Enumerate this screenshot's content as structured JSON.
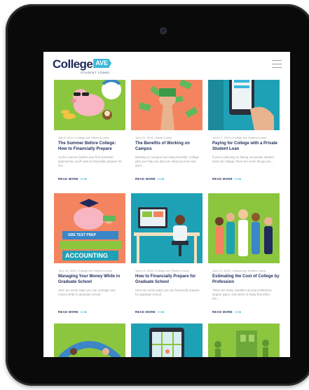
{
  "header": {
    "logo_word": "College",
    "logo_ave": "AVE",
    "logo_sub": "STUDENT LOANS"
  },
  "read_more_label": "READ MORE",
  "cards": [
    {
      "meta": "July 8, 2019 | College Ave Student Loans",
      "title": "The Summer Before College: How to Financially Prepare",
      "excerpt": "As the summer before your first semester approaches you'll want to financially prepare for the..."
    },
    {
      "meta": "June 10, 2019 | Karen Cohen",
      "title": "The Benefits of Working on Campus",
      "excerpt": "Working on campus has many benefits. College jobs can help you discover what you love and don't..."
    },
    {
      "meta": "June 17, 2019 | College Ave Student Loans",
      "title": "Paying for College with a Private Student Loan",
      "excerpt": "If you're planning on taking out private student loans for college, there are some things you..."
    },
    {
      "meta": "June 14, 2019 | College Ave Student Loans",
      "title": "Managing Your Money While in Graduate School",
      "excerpt": "Here are some ways you can manage your money while in graduate school."
    },
    {
      "meta": "June 13, 2019 | College Ave Student Loans",
      "title": "How to Financially Prepare for Graduate School",
      "excerpt": "Here are some ways you can financially prepare for graduate school."
    },
    {
      "meta": "June 11, 2019 | College Ave Student Loans",
      "title": "Estimating the Cost of College by Profession",
      "excerpt": "There are many variables among institutions, degree types, and areas of study that affect the..."
    }
  ],
  "thumb_text": {
    "test_prep": "GRE TEST PREP",
    "accounting": "ACCOUNTING"
  },
  "colors": {
    "navy": "#1f2b5c",
    "accent": "#3cb8d9",
    "green": "#8cc63f",
    "orange": "#f4845f",
    "teal": "#1fa1b5"
  }
}
